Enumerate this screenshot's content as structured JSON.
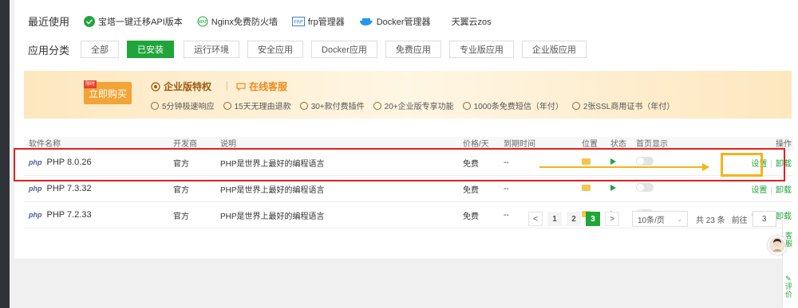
{
  "recent": {
    "label": "最近使用",
    "items": [
      {
        "label": "宝塔一键迁移API版本",
        "icon": "check-circle-icon"
      },
      {
        "label": "Nginx免费防火墙",
        "icon": "waf-icon"
      },
      {
        "label": "frp管理器",
        "icon": "frp-icon"
      },
      {
        "label": "Docker管理器",
        "icon": "docker-whale-icon"
      },
      {
        "label": "天翼云zos",
        "icon": ""
      }
    ]
  },
  "categories": {
    "label": "应用分类",
    "items": [
      "全部",
      "已安装",
      "运行环境",
      "安全应用",
      "Docker应用",
      "免费应用",
      "专业版应用",
      "企业版应用"
    ],
    "active": "已安装"
  },
  "banner": {
    "buy_label": "立即购买",
    "ribbon_label": "限时",
    "enterprise_title": "企业版特权",
    "service_title": "在线客服",
    "features": [
      "5分钟极速响应",
      "15天无理由退款",
      "30+款付费插件",
      "20+企业版专享功能",
      "1000条免费短信（年付）",
      "2张SSL商用证书（年付）"
    ]
  },
  "table": {
    "headers": [
      "软件名称",
      "开发商",
      "说明",
      "价格/天",
      "到期时间",
      "位置",
      "状态",
      "首页显示",
      "操作"
    ],
    "rows": [
      {
        "logo": "php",
        "name": "PHP 8.0.26",
        "vendor": "官方",
        "desc": "PHP是世界上最好的编程语言",
        "price": "免费",
        "expire": "--",
        "set": "设置",
        "uninstall": "卸载"
      },
      {
        "logo": "php",
        "name": "PHP 7.3.32",
        "vendor": "官方",
        "desc": "PHP是世界上最好的编程语言",
        "price": "免费",
        "expire": "--",
        "set": "设置",
        "uninstall": "卸载"
      },
      {
        "logo": "php",
        "name": "PHP 7.2.33",
        "vendor": "官方",
        "desc": "PHP是世界上最好的编程语言",
        "price": "免费",
        "expire": "--",
        "set": "设置",
        "uninstall": "卸载"
      }
    ]
  },
  "pager": {
    "prev": "<",
    "pages": [
      "1",
      "2",
      "3"
    ],
    "current": "3",
    "next": ">",
    "page_size": "10条/页",
    "total": "共 23 条",
    "goto_label": "前往",
    "goto_value": "3"
  },
  "side": {
    "service_short": "客服",
    "feedback": "评价"
  },
  "colors": {
    "accent": "#20a53a",
    "highlight_red": "#e02020",
    "highlight_yellow": "#f2b418"
  }
}
